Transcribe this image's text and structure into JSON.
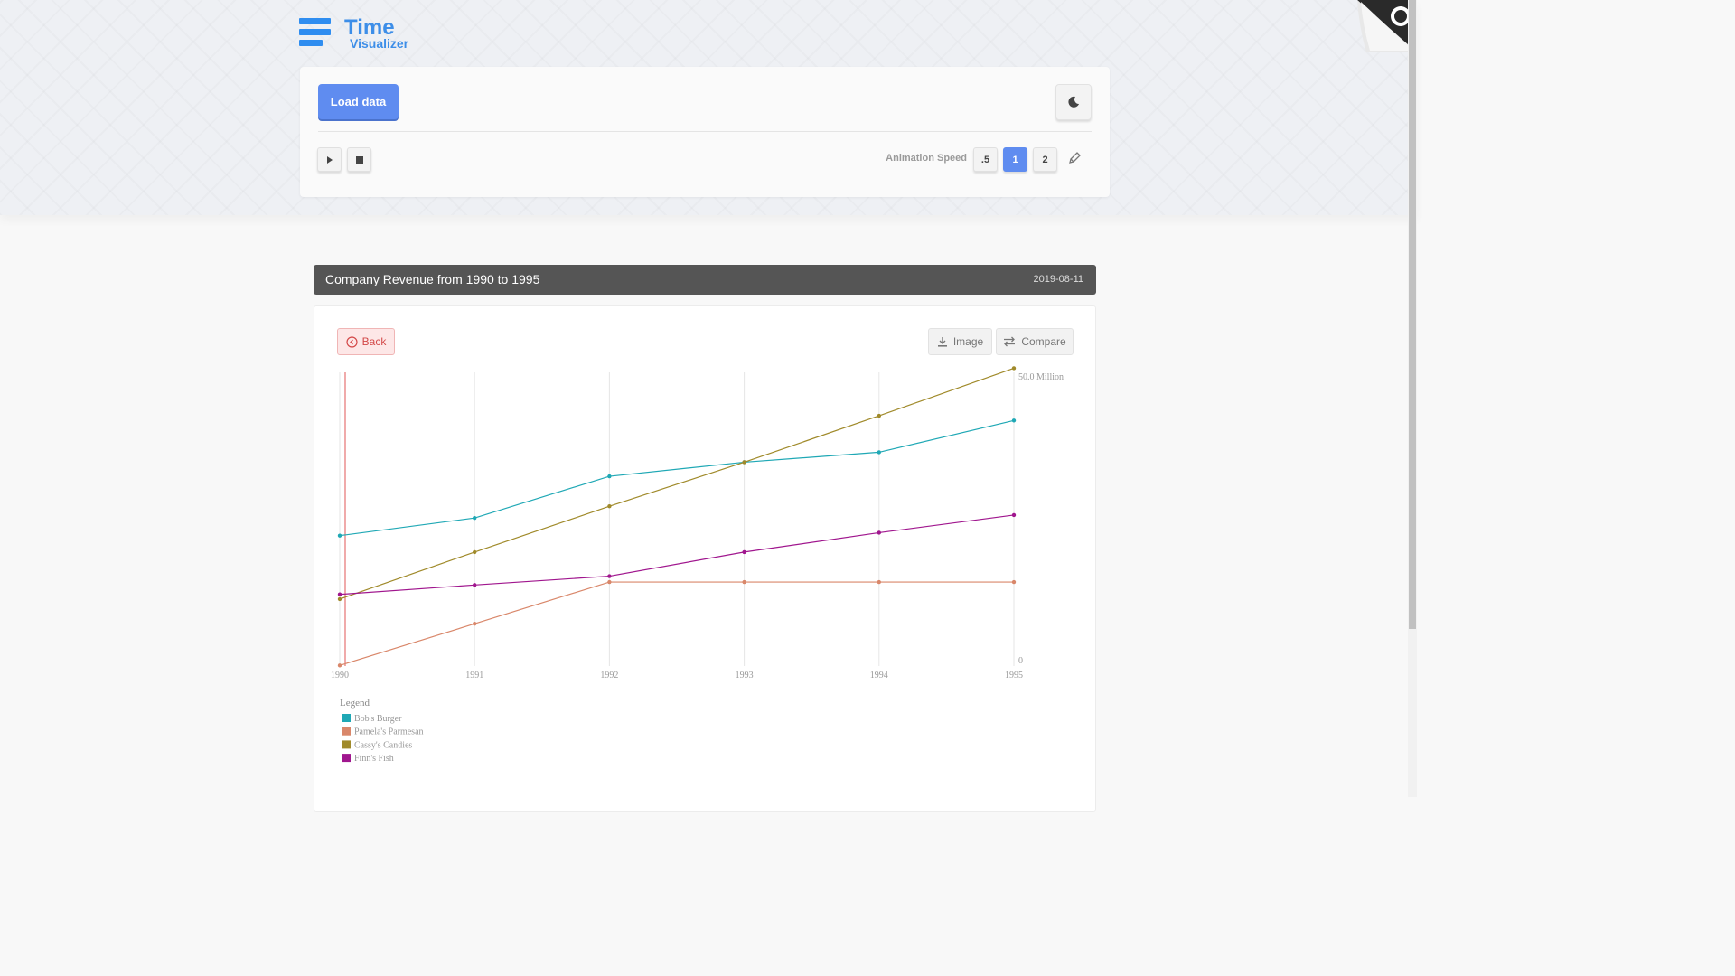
{
  "app": {
    "title": "Time",
    "subtitle": "Visualizer"
  },
  "toolbar": {
    "load_label": "Load data",
    "speed_label": "Animation Speed",
    "speeds": [
      ".5",
      "1",
      "2"
    ],
    "active_speed": "1"
  },
  "panel": {
    "title": "Company Revenue from 1990 to 1995",
    "date": "2019-08-11"
  },
  "actions": {
    "back": "Back",
    "image": "Image",
    "compare": "Compare"
  },
  "colors": {
    "accent": "#5f8cf0",
    "brand": "#2f8df0",
    "title_bar": "#555555"
  },
  "chart_data": {
    "type": "line",
    "x": [
      1990,
      1991,
      1992,
      1993,
      1994,
      1995
    ],
    "ylim": [
      0,
      50
    ],
    "y_axis_labels": {
      "max": "50.0 Million",
      "min": "0"
    },
    "legend_title": "Legend",
    "legend_position": "bottom-left",
    "grid": "vertical",
    "series": [
      {
        "name": "Bob's Burger",
        "color": "#1fa8b5",
        "values": [
          22.2,
          25.2,
          32.3,
          34.7,
          36.4,
          41.8
        ]
      },
      {
        "name": "Pamela's Parmesan",
        "color": "#d9876a",
        "values": [
          0.1,
          7.2,
          14.3,
          14.3,
          14.3,
          14.3
        ]
      },
      {
        "name": "Cassy's Candies",
        "color": "#a08a2a",
        "values": [
          11.4,
          19.4,
          27.2,
          34.7,
          42.6,
          50.7
        ]
      },
      {
        "name": "Finn's Fish",
        "color": "#a0168e",
        "values": [
          12.2,
          13.8,
          15.3,
          19.4,
          22.7,
          25.7
        ]
      }
    ]
  }
}
